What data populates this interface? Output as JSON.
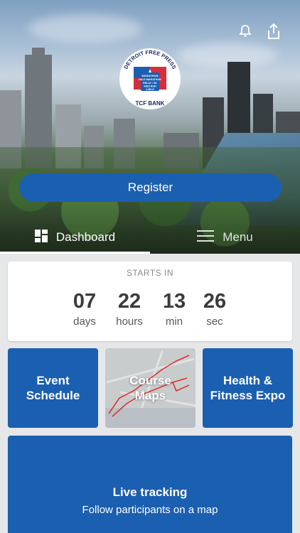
{
  "logo": {
    "top_text": "DETROIT FREE PRESS",
    "events": [
      "MARATHON",
      "HALF-MARATHON",
      "RELAY • 5K",
      "KIDS RUN",
      "1-MILE"
    ],
    "bottom_text": "TCF BANK"
  },
  "hero": {
    "register_label": "Register"
  },
  "nav": {
    "dashboard_label": "Dashboard",
    "menu_label": "Menu"
  },
  "countdown": {
    "heading": "STARTS IN",
    "units": [
      {
        "value": "07",
        "label": "days"
      },
      {
        "value": "22",
        "label": "hours"
      },
      {
        "value": "13",
        "label": "min"
      },
      {
        "value": "26",
        "label": "sec"
      }
    ]
  },
  "tiles": {
    "event_schedule": "Event\nSchedule",
    "course_maps": "Course\nMaps",
    "health_expo": "Health &\nFitness Expo"
  },
  "live_tracking": {
    "title": "Live tracking",
    "subtitle": "Follow participants on a map"
  },
  "colors": {
    "primary": "#1b5fb0",
    "background": "#e6e7e9"
  }
}
